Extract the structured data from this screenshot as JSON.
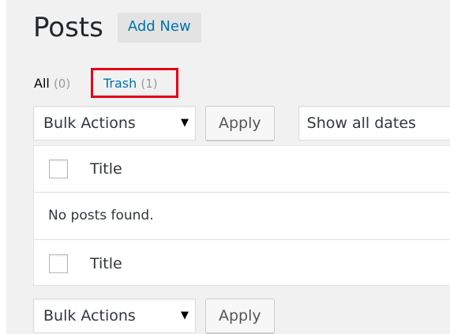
{
  "header": {
    "title": "Posts",
    "add_new_label": "Add New"
  },
  "views": {
    "all_label": "All",
    "all_count": "(0)",
    "trash_label": "Trash",
    "trash_count": "(1)"
  },
  "tablenav_top": {
    "bulk_actions": "Bulk Actions",
    "apply_label": "Apply",
    "dates_filter": "Show all dates"
  },
  "table": {
    "header_title": "Title",
    "empty_message": "No posts found.",
    "footer_title": "Title"
  },
  "tablenav_bottom": {
    "bulk_actions": "Bulk Actions",
    "apply_label": "Apply"
  },
  "colors": {
    "link": "#0073aa",
    "highlight_box": "#e0001a",
    "background": "#f1f1f1"
  },
  "icons": {
    "select_arrow": "triangle-down-icon"
  }
}
